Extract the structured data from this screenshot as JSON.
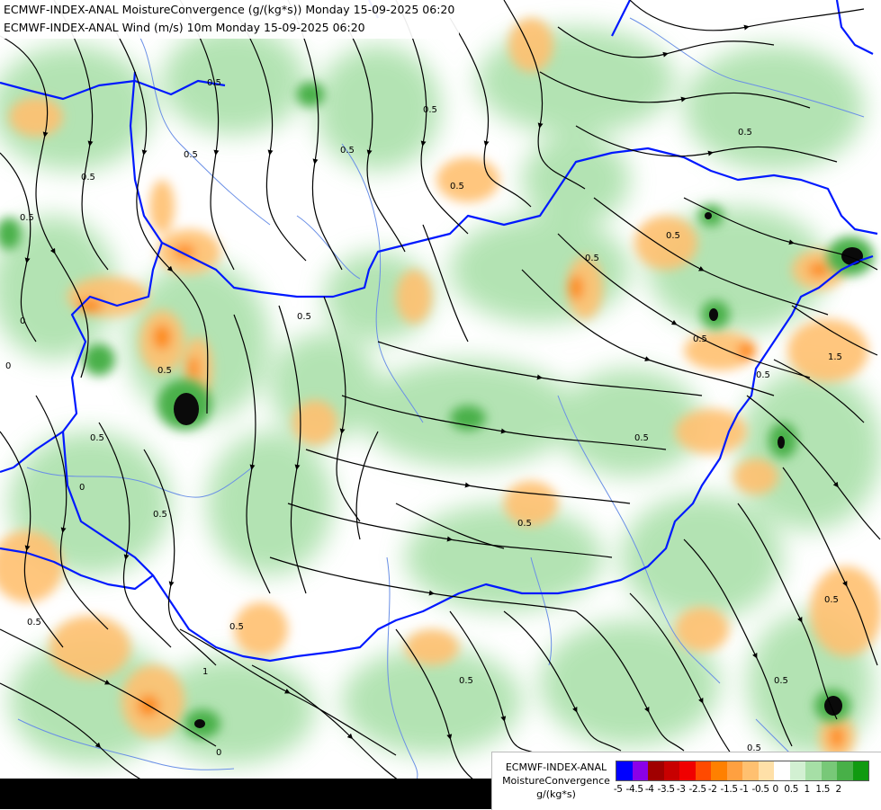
{
  "header": {
    "line1": "ECMWF-INDEX-ANAL MoistureConvergence (g/(kg*s)) Monday 15-09-2025 06:20",
    "line2": "ECMWF-INDEX-ANAL Wind (m/s) 10m Monday 15-09-2025 06:20"
  },
  "map": {
    "contour_labels": [
      "0.5",
      "0",
      "1",
      "1.5"
    ],
    "colors": {
      "border": "#0019ff",
      "river": "#6a8fe6",
      "streamline": "#000000",
      "background": "#ffffff"
    }
  },
  "legend": {
    "title_line1": "ECMWF-INDEX-ANAL",
    "title_line2": "MoistureConvergence",
    "unit": "g/(kg*s)",
    "colors": [
      "#0000ff",
      "#8a00e8",
      "#a00000",
      "#c80000",
      "#f00000",
      "#ff4a00",
      "#ff8000",
      "#ffa040",
      "#ffc070",
      "#ffe0a8",
      "#ffffff",
      "#d2f0d2",
      "#a6dfa6",
      "#78c878",
      "#48b048",
      "#109a10"
    ],
    "ticks": [
      "-5",
      "-4.5",
      "-4",
      "-3.5",
      "-3",
      "-2.5",
      "-2",
      "-1.5",
      "-1",
      "-0.5",
      "0",
      "0.5",
      "1",
      "1.5",
      "2"
    ]
  }
}
